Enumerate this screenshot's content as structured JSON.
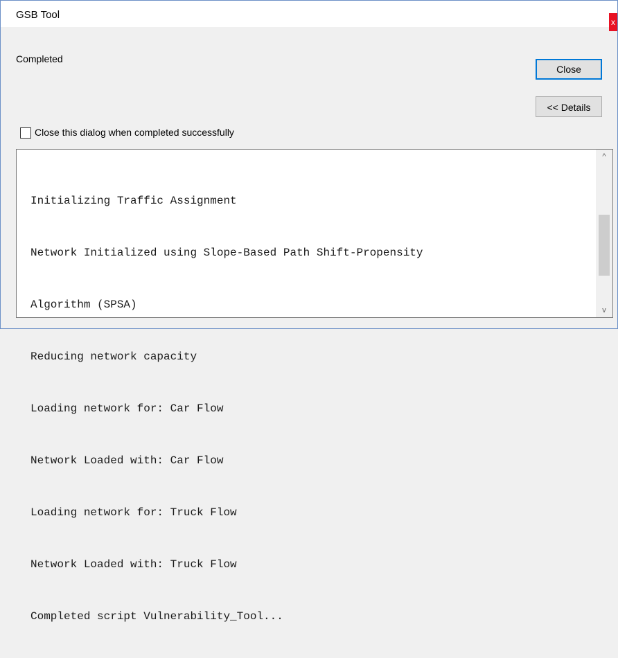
{
  "window": {
    "title": "GSB Tool",
    "close_glyph": "x"
  },
  "status": {
    "text": "Completed"
  },
  "buttons": {
    "close_label": "Close",
    "details_label": "<< Details"
  },
  "checkbox": {
    "label": "Close this dialog when completed successfully",
    "checked": false
  },
  "log": {
    "lines": [
      "Initializing Traffic Assignment",
      "Network Initialized using Slope-Based Path Shift-Propensity",
      "Algorithm (SPSA)",
      "Reducing network capacity",
      "Loading network for: Car Flow",
      "Network Loaded with: Car Flow",
      "Loading network for: Truck Flow",
      "Network Loaded with: Truck Flow",
      "Completed script Vulnerability_Tool..."
    ]
  },
  "scrollbar": {
    "up_glyph": "^",
    "down_glyph": "v"
  }
}
